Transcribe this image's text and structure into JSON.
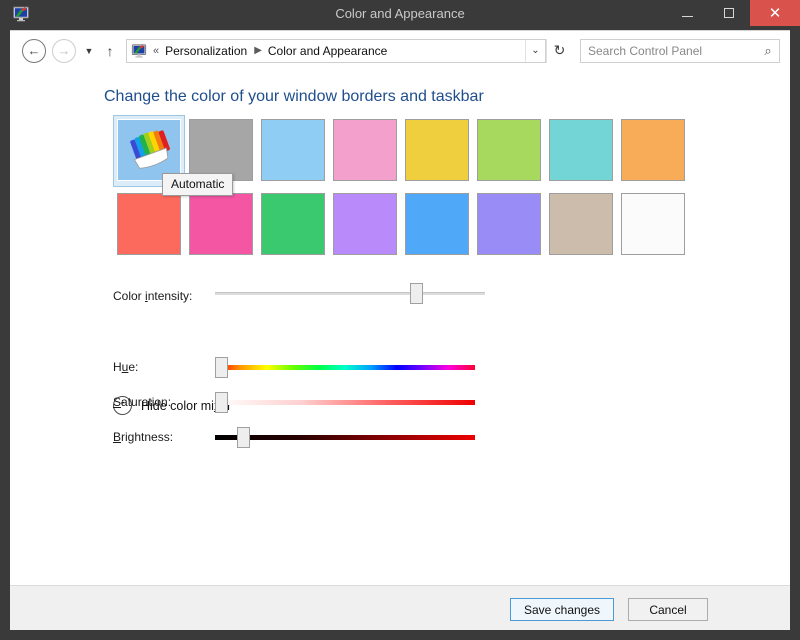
{
  "window": {
    "title": "Color and Appearance",
    "icon": "personalization-monitor-icon",
    "controls": {
      "minimize": "minimize-icon",
      "maximize": "maximize-icon",
      "close": "✕"
    }
  },
  "nav": {
    "back": "back-arrow-icon",
    "back_glyph": "←",
    "forward": "forward-arrow-icon",
    "forward_glyph": "→",
    "recent_dropdown_glyph": "▼",
    "up_glyph": "↑",
    "address": {
      "icon": "personalization-monitor-icon",
      "chevrons": "«",
      "crumbs": [
        "Personalization",
        "Color and Appearance"
      ],
      "separator": "▶",
      "caret_glyph": "⌄"
    },
    "refresh_glyph": "↻",
    "search": {
      "placeholder": "Search Control Panel",
      "value": "",
      "icon_glyph": "⌕"
    }
  },
  "main": {
    "heading": "Change the color of your window borders and taskbar",
    "heading_color": "#1f4e8c",
    "swatches": {
      "selected_index": 0,
      "tooltip": "Automatic",
      "rows": [
        [
          {
            "name": "automatic",
            "color": "#8ec4ee",
            "label": "Automatic",
            "selected": true
          },
          {
            "name": "gray",
            "color": "#a6a6a6",
            "selected": false
          },
          {
            "name": "light-blue",
            "color": "#90cdf4",
            "selected": false
          },
          {
            "name": "pink",
            "color": "#f4a0cd",
            "selected": false
          },
          {
            "name": "yellow",
            "color": "#efcf3d",
            "selected": false
          },
          {
            "name": "yellow-green",
            "color": "#a8d койка",
            "selected": false
          },
          {
            "name": "turquoise",
            "color": "#73d5d5",
            "selected": false
          },
          {
            "name": "orange",
            "color": "#f9ac57",
            "selected": false
          }
        ],
        [
          {
            "name": "salmon-red",
            "color": "#fc6a5d",
            "selected": false
          },
          {
            "name": "magenta",
            "color": "#f456a4",
            "selected": false
          },
          {
            "name": "green",
            "color": "#3bc96f",
            "selected": false
          },
          {
            "name": "lavender",
            "color": "#b98af9",
            "selected": false
          },
          {
            "name": "blue",
            "color": "#4fa8f8",
            "selected": false
          },
          {
            "name": "periwinkle",
            "color": "#9a8cf7",
            "selected": false
          },
          {
            "name": "taupe",
            "color": "#cbbcab",
            "selected": false
          },
          {
            "name": "white",
            "color": "#fbfbfb",
            "selected": false
          }
        ]
      ]
    },
    "intensity": {
      "label_pre": "Color ",
      "label_accel": "i",
      "label_post": "ntensity:",
      "value_pct": 76
    },
    "mixer_toggle": {
      "chevron_glyph": "⌃",
      "label_pre": "Hide color mi",
      "label_accel": "x",
      "label_post": "er"
    },
    "mixer": [
      {
        "name": "hue",
        "label_pre": "H",
        "label_accel": "u",
        "label_post": "e:",
        "value_pct": 0,
        "gradient": "linear-gradient(to right,#ff0000,#ff9900,#ffff00,#66ff00,#00ff44,#00ffcc,#00a0ff,#0000ff,#7700ff,#ff00dd,#ff0033)"
      },
      {
        "name": "saturation",
        "label_pre": "",
        "label_accel": "S",
        "label_post": "aturation:",
        "value_pct": 0,
        "gradient": "linear-gradient(to right,#ffffff,#ffd0d0,#ff6060,#ee0000)"
      },
      {
        "name": "brightness",
        "label_pre": "",
        "label_accel": "B",
        "label_post": "rightness:",
        "value_pct": 9,
        "gradient": "linear-gradient(to right,#000000,#2a0000,#8b0000,#ee0000)"
      }
    ]
  },
  "footer": {
    "save_label": "Save changes",
    "cancel_label": "Cancel"
  }
}
